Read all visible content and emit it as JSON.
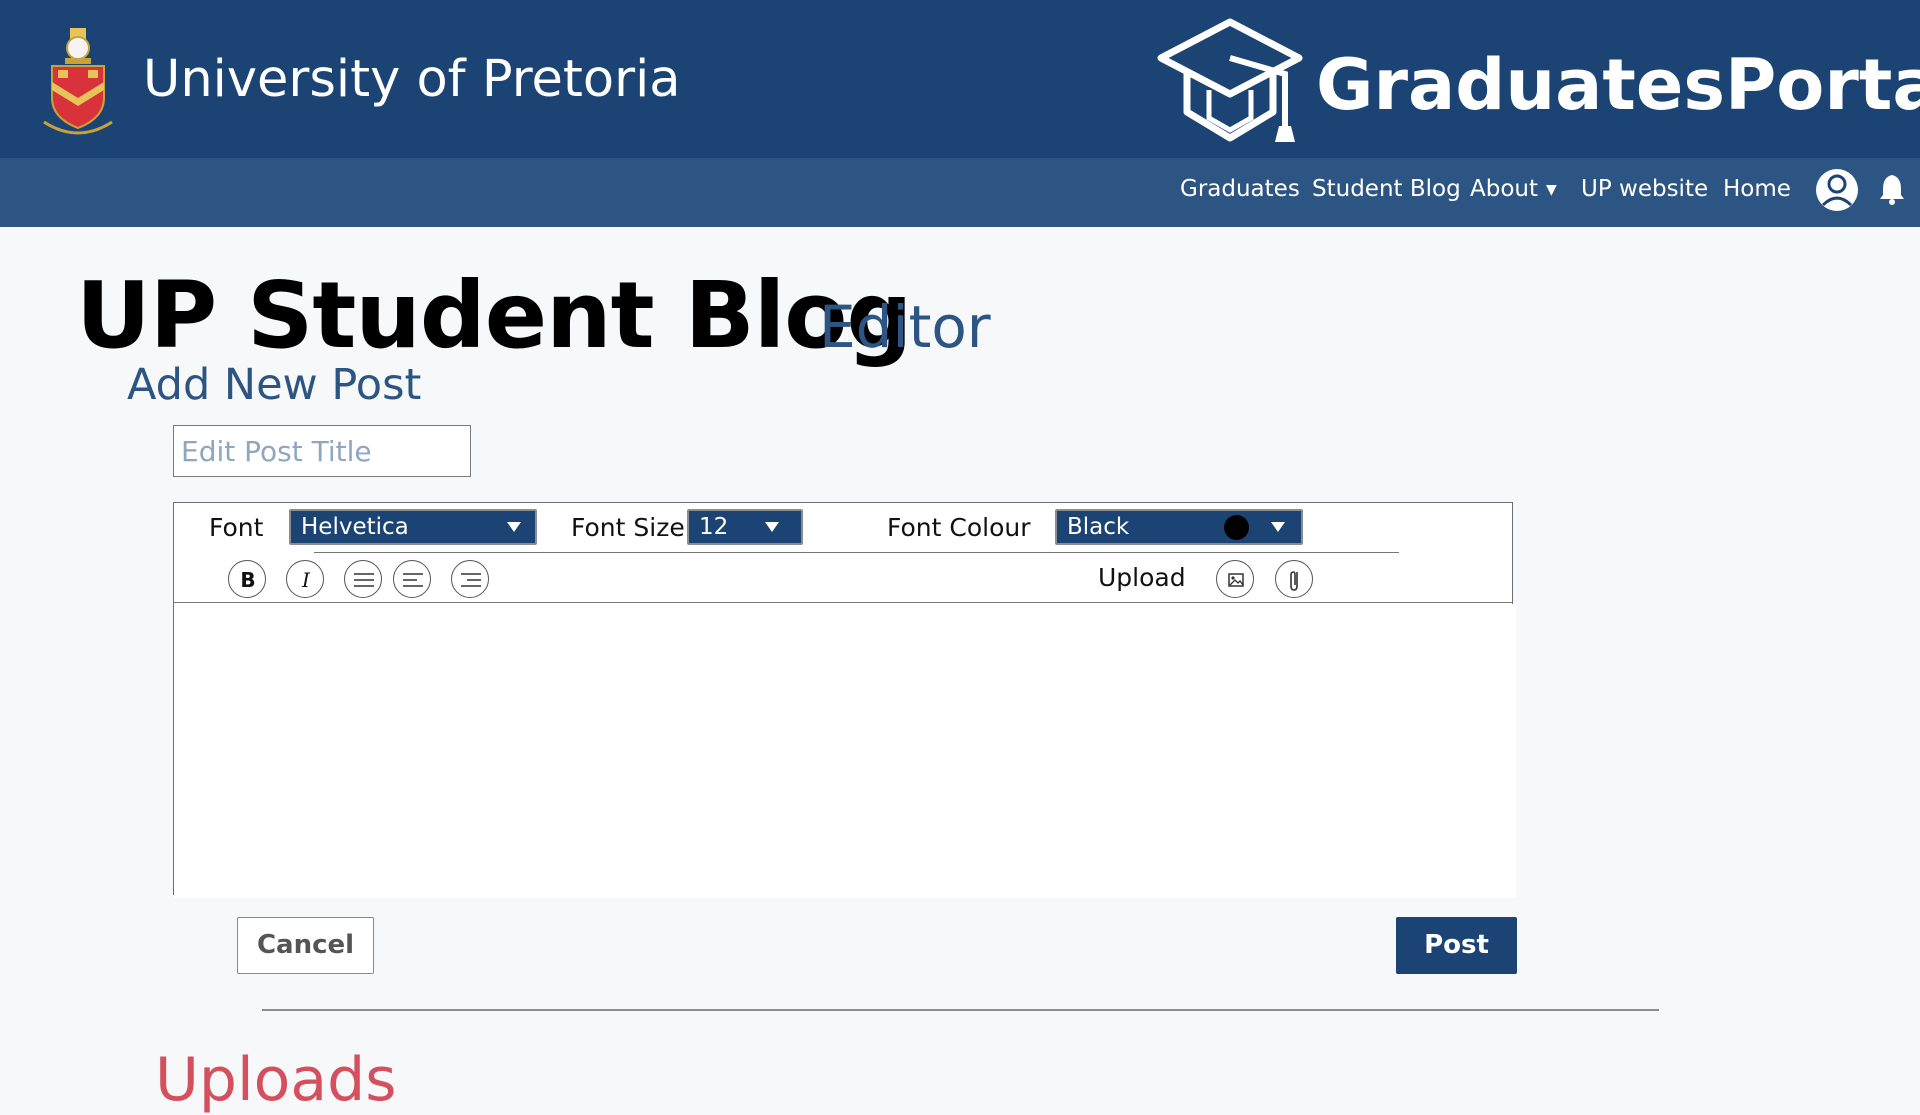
{
  "header": {
    "university_name": "University of Pretoria",
    "portal_name": "GraduatesPortal",
    "crest_icon": "university-crest-icon",
    "portal_icon": "graduation-cap-icon"
  },
  "nav": {
    "items": [
      {
        "label": "Graduates"
      },
      {
        "label": "Student Blog"
      },
      {
        "label": "About"
      },
      {
        "label": "UP website"
      },
      {
        "label": "Home"
      }
    ],
    "about_caret": "▼",
    "icons": [
      "user-profile-icon",
      "bell-icon"
    ]
  },
  "page": {
    "title": "UP Student Blog",
    "subtitle": "Editor",
    "section_title": "Add New Post",
    "post_title_placeholder": "Edit Post Title",
    "post_title_value": ""
  },
  "toolbar": {
    "font_label": "Font",
    "font_value": "Helvetica",
    "font_size_label": "Font Size",
    "font_size_value": "12",
    "font_colour_label": "Font Colour",
    "font_colour_value": "Black",
    "font_colour_swatch": "#000000",
    "upload_label": "Upload",
    "buttons": [
      "bold-icon",
      "italic-icon",
      "align-justify-icon",
      "align-left-icon",
      "align-right-icon"
    ],
    "upload_icons": [
      "image-icon",
      "paperclip-icon"
    ]
  },
  "editor": {
    "body_value": ""
  },
  "actions": {
    "cancel_label": "Cancel",
    "post_label": "Post"
  },
  "uploads": {
    "heading": "Uploads"
  },
  "colors": {
    "brand_dark": "#1b4475",
    "brand_mid": "#2d5583",
    "accent_red": "#d4505e"
  }
}
